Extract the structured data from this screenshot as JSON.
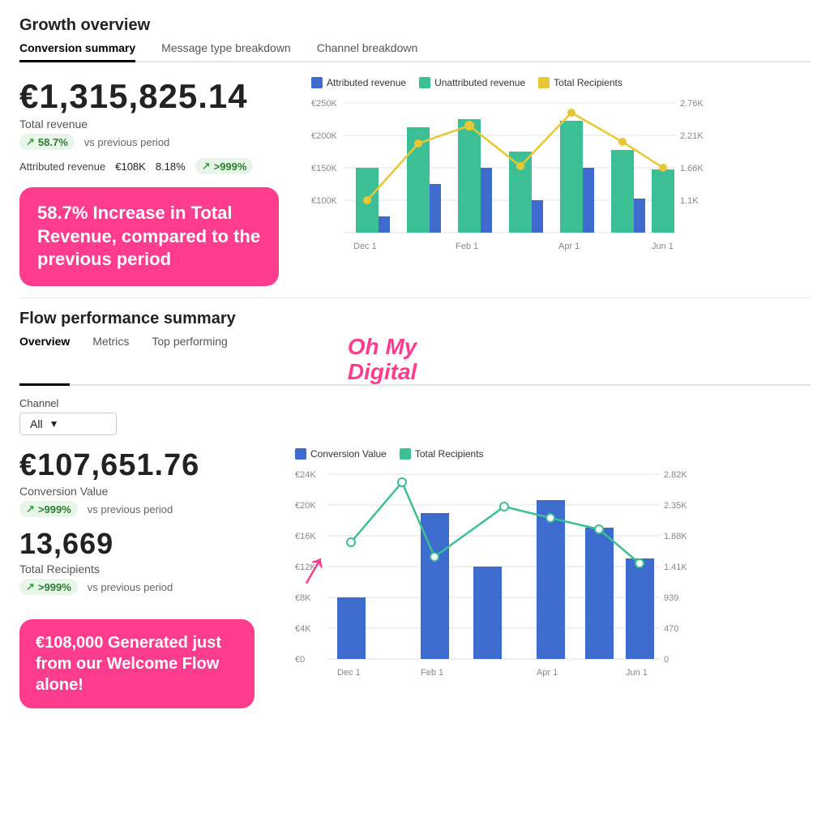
{
  "page": {
    "growth_title": "Growth overview",
    "tabs": [
      {
        "label": "Conversion summary",
        "active": true
      },
      {
        "label": "Message type breakdown",
        "active": false
      },
      {
        "label": "Channel breakdown",
        "active": false
      }
    ],
    "conversion": {
      "big_number": "€1,315,825.14",
      "total_revenue_label": "Total revenue",
      "badge_value": "58.7%",
      "vs_text": "vs previous period",
      "attributed_label": "Attributed revenue",
      "attributed_value": "€108K",
      "attributed_pct": "8.18%",
      "attributed_badge": ">999%",
      "callout_text": "58.7% Increase in Total Revenue, compared to the previous period",
      "legend": [
        {
          "label": "Attributed revenue",
          "color": "#3d6bce"
        },
        {
          "label": "Unattributed revenue",
          "color": "#3dbf96"
        },
        {
          "label": "Total Recipients",
          "color": "#e6c832"
        }
      ],
      "chart_y_labels": [
        "€250K",
        "€200K",
        "€150K",
        "€100K"
      ],
      "chart_y2_labels": [
        "2.76K",
        "2.21K",
        "1.66K",
        "1.1K"
      ],
      "chart_x_labels": [
        "Dec 1",
        "Feb 1",
        "Apr 1",
        "Jun 1"
      ]
    },
    "flow": {
      "title": "Flow performance summary",
      "sub_tabs": [
        {
          "label": "Overview",
          "active": true
        },
        {
          "label": "Metrics",
          "active": false
        },
        {
          "label": "Top performing",
          "active": false
        }
      ],
      "channel_label": "Channel",
      "channel_value": "All",
      "big_number": "€107,651.76",
      "conv_value_label": "Conversion Value",
      "conv_badge": ">999%",
      "vs_text": "vs previous period",
      "recipients_number": "13,669",
      "recipients_label": "Total Recipients",
      "recipients_badge": ">999%",
      "callout_text": "€108,000 Generated just from our Welcome Flow alone!",
      "legend2": [
        {
          "label": "Conversion Value",
          "color": "#3d6bce"
        },
        {
          "label": "Total Recipients",
          "color": "#3dbf96"
        }
      ],
      "chart2_y_labels": [
        "€24K",
        "€20K",
        "€16K",
        "€12K",
        "€8K",
        "€4K",
        "€0"
      ],
      "chart2_y2_labels": [
        "2.82K",
        "2.35K",
        "1.88K",
        "1.41K",
        "939",
        "470",
        "0"
      ],
      "chart2_x_labels": [
        "Dec 1",
        "Feb 1",
        "Apr 1",
        "Jun 1"
      ]
    },
    "brand": {
      "name_line1": "Oh My",
      "name_line2": "Digital"
    }
  }
}
